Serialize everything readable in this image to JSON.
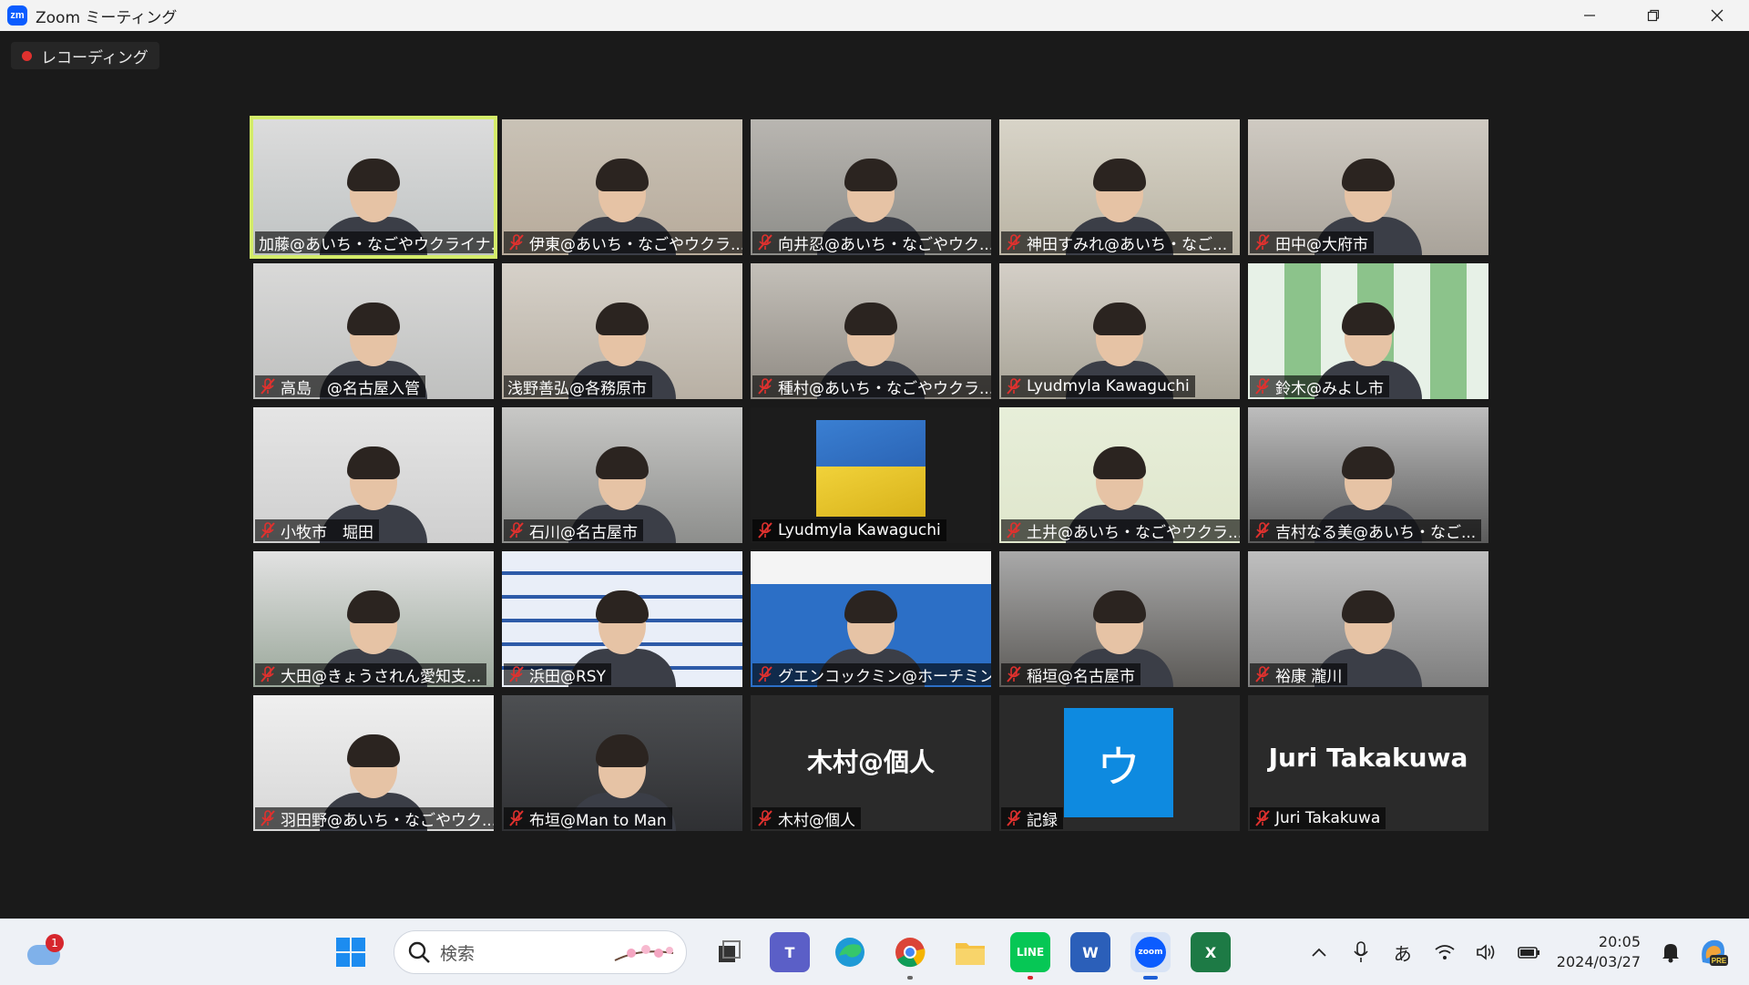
{
  "window": {
    "app_icon_text": "zm",
    "title": "Zoom ミーティング"
  },
  "recording": {
    "label": "レコーディング",
    "dot_color": "#e0312e"
  },
  "tiles": [
    {
      "name": "加藤@あいち・なごやウクライナ...",
      "muted": false,
      "active": true
    },
    {
      "name": "伊東@あいち・なごやウクラ...",
      "muted": true
    },
    {
      "name": "向井忍@あいち・なごやウク...",
      "muted": true
    },
    {
      "name": "神田すみれ@あいち・なご...",
      "muted": true
    },
    {
      "name": "田中@大府市",
      "muted": true
    },
    {
      "name": "高島　@名古屋入管",
      "muted": true
    },
    {
      "name": "浅野善弘@各務原市",
      "muted": false
    },
    {
      "name": "種村@あいち・なごやウクラ...",
      "muted": true
    },
    {
      "name": "Lyudmyla Kawaguchi",
      "muted": true
    },
    {
      "name": "鈴木@みよし市",
      "muted": true
    },
    {
      "name": "小牧市　堀田",
      "muted": true
    },
    {
      "name": "石川@名古屋市",
      "muted": true
    },
    {
      "name": "Lyudmyla Kawaguchi",
      "muted": true,
      "type": "flag"
    },
    {
      "name": "土井@あいち・なごやウクラ...",
      "muted": true
    },
    {
      "name": "吉村なる美@あいち・なご...",
      "muted": true
    },
    {
      "name": "大田@きょうされん愛知支...",
      "muted": true
    },
    {
      "name": "浜田@RSY",
      "muted": true
    },
    {
      "name": "グエンコックミン@ホーチミン...",
      "muted": true
    },
    {
      "name": "稲垣@名古屋市",
      "muted": true
    },
    {
      "name": "裕康 瀧川",
      "muted": true
    },
    {
      "name": "羽田野@あいち・なごやウク...",
      "muted": true
    },
    {
      "name": "布垣@Man to Man",
      "muted": true
    },
    {
      "name": "木村@個人",
      "muted": true,
      "type": "text",
      "big_text": "木村@個人"
    },
    {
      "name": "記録",
      "muted": true,
      "type": "avatar",
      "avatar_char": "ウ"
    },
    {
      "name": "Juri Takakuwa",
      "muted": true,
      "type": "text",
      "big_text": "Juri Takakuwa"
    }
  ],
  "taskbar": {
    "weather_badge": "1",
    "search_placeholder": "検索",
    "ime_indicator": "あ",
    "time": "20:05",
    "date": "2024/03/27",
    "apps": [
      "start-icon",
      "task-view-icon",
      "teams-icon",
      "edge-icon",
      "chrome-icon",
      "file-explorer-icon",
      "line-icon",
      "word-icon",
      "zoom-icon",
      "excel-icon"
    ]
  },
  "colors": {
    "active_speaker_border": "#d4ec6a",
    "mute_icon": "#e0312e",
    "zoom_blue": "#0b5cff"
  }
}
